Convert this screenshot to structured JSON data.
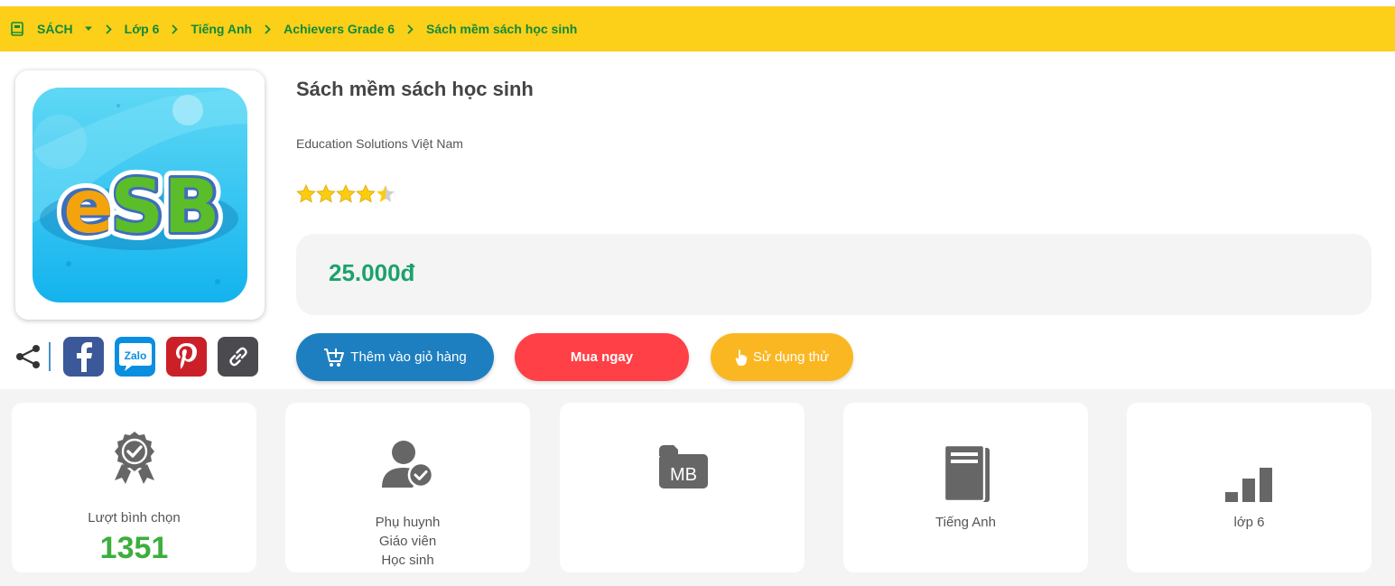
{
  "breadcrumb": {
    "items": [
      "SÁCH",
      "Lớp 6",
      "Tiếng Anh",
      "Achievers Grade 6",
      "Sách mềm sách học sinh"
    ]
  },
  "product": {
    "cover_logo_text": "eSB",
    "title": "Sách mềm sách học sinh",
    "publisher": "Education Solutions Việt Nam",
    "rating": 4.5,
    "rating_max": 5,
    "price": "25.000đ"
  },
  "share": {
    "social": [
      {
        "name": "facebook",
        "color": "#3b5998"
      },
      {
        "name": "zalo",
        "label": "Zalo",
        "color": "#0a8ee0"
      },
      {
        "name": "pinterest",
        "color": "#cb2027"
      },
      {
        "name": "copy-link",
        "color": "#4a4a4f"
      }
    ]
  },
  "actions": {
    "add_to_cart": "Thêm vào giỏ hàng",
    "buy_now": "Mua ngay",
    "try": "Sử dụng thử"
  },
  "stats": {
    "votes_label": "Lượt bình chọn",
    "votes_value": "1351",
    "audience": [
      "Phụ huynh",
      "Giáo viên",
      "Học sinh"
    ],
    "size_unit": "MB",
    "subject": "Tiếng Anh",
    "grade": "lớp 6"
  },
  "colors": {
    "breadcrumb_bg": "#fccf19",
    "breadcrumb_text": "#0f8b3a",
    "price": "#1ba26b",
    "cart_button": "#1e7fc0",
    "buy_button": "#ff4047",
    "try_button": "#fbb722",
    "votes_number": "#3cae3d"
  }
}
